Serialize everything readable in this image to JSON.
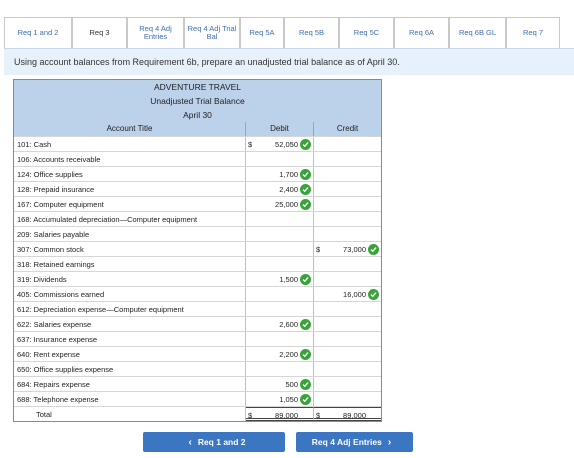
{
  "tabs": [
    {
      "label": "Req 1 and 2",
      "width": 68
    },
    {
      "label": "Req 3",
      "width": 55,
      "active": true
    },
    {
      "label": "Req 4 Adj Entries",
      "width": 57
    },
    {
      "label": "Req 4 Adj Trial Bal",
      "width": 56
    },
    {
      "label": "Req 5A",
      "width": 44
    },
    {
      "label": "Req 5B",
      "width": 55
    },
    {
      "label": "Req 5C",
      "width": 55
    },
    {
      "label": "Req 6A",
      "width": 55
    },
    {
      "label": "Req 6B GL",
      "width": 57
    },
    {
      "label": "Req 7",
      "width": 54
    }
  ],
  "instruction": "Using account balances from Requirement 6b, prepare an unadjusted trial balance as of April 30.",
  "trial_balance": {
    "company": "ADVENTURE TRAVEL",
    "report": "Unadjusted Trial Balance",
    "date": "April 30",
    "col_account": "Account Title",
    "col_debit": "Debit",
    "col_credit": "Credit",
    "rows": [
      {
        "account": "101: Cash",
        "debit_dollar": "$",
        "debit": "52,050",
        "debit_check": true,
        "credit_dollar": "",
        "credit": "",
        "credit_check": false
      },
      {
        "account": "106: Accounts receivable",
        "debit_dollar": "",
        "debit": "",
        "debit_check": false,
        "credit_dollar": "",
        "credit": "",
        "credit_check": false
      },
      {
        "account": "124: Office supplies",
        "debit_dollar": "",
        "debit": "1,700",
        "debit_check": true,
        "credit_dollar": "",
        "credit": "",
        "credit_check": false
      },
      {
        "account": "128: Prepaid insurance",
        "debit_dollar": "",
        "debit": "2,400",
        "debit_check": true,
        "credit_dollar": "",
        "credit": "",
        "credit_check": false
      },
      {
        "account": "167: Computer equipment",
        "debit_dollar": "",
        "debit": "25,000",
        "debit_check": true,
        "credit_dollar": "",
        "credit": "",
        "credit_check": false
      },
      {
        "account": "168: Accumulated depreciation—Computer equipment",
        "debit_dollar": "",
        "debit": "",
        "debit_check": false,
        "credit_dollar": "",
        "credit": "",
        "credit_check": false
      },
      {
        "account": "209: Salaries payable",
        "debit_dollar": "",
        "debit": "",
        "debit_check": false,
        "credit_dollar": "",
        "credit": "",
        "credit_check": false
      },
      {
        "account": "307: Common stock",
        "debit_dollar": "",
        "debit": "",
        "debit_check": false,
        "credit_dollar": "$",
        "credit": "73,000",
        "credit_check": true
      },
      {
        "account": "318: Retained earnings",
        "debit_dollar": "",
        "debit": "",
        "debit_check": false,
        "credit_dollar": "",
        "credit": "",
        "credit_check": false
      },
      {
        "account": "319: Dividends",
        "debit_dollar": "",
        "debit": "1,500",
        "debit_check": true,
        "credit_dollar": "",
        "credit": "",
        "credit_check": false
      },
      {
        "account": "405: Commissions earned",
        "debit_dollar": "",
        "debit": "",
        "debit_check": false,
        "credit_dollar": "",
        "credit": "16,000",
        "credit_check": true
      },
      {
        "account": "612: Depreciation expense—Computer equipment",
        "debit_dollar": "",
        "debit": "",
        "debit_check": false,
        "credit_dollar": "",
        "credit": "",
        "credit_check": false
      },
      {
        "account": "622: Salaries expense",
        "debit_dollar": "",
        "debit": "2,600",
        "debit_check": true,
        "credit_dollar": "",
        "credit": "",
        "credit_check": false
      },
      {
        "account": "637: Insurance expense",
        "debit_dollar": "",
        "debit": "",
        "debit_check": false,
        "credit_dollar": "",
        "credit": "",
        "credit_check": false
      },
      {
        "account": "640: Rent expense",
        "debit_dollar": "",
        "debit": "2,200",
        "debit_check": true,
        "credit_dollar": "",
        "credit": "",
        "credit_check": false
      },
      {
        "account": "650: Office supplies expense",
        "debit_dollar": "",
        "debit": "",
        "debit_check": false,
        "credit_dollar": "",
        "credit": "",
        "credit_check": false
      },
      {
        "account": "684: Repairs expense",
        "debit_dollar": "",
        "debit": "500",
        "debit_check": true,
        "credit_dollar": "",
        "credit": "",
        "credit_check": false
      },
      {
        "account": "688: Telephone expense",
        "debit_dollar": "",
        "debit": "1,050",
        "debit_check": true,
        "credit_dollar": "",
        "credit": "",
        "credit_check": false
      }
    ],
    "total": {
      "label": "Total",
      "debit_dollar": "$",
      "debit": "89,000",
      "credit_dollar": "$",
      "credit": "89,000"
    }
  },
  "nav": {
    "prev_label": "Req 1 and 2",
    "next_label": "Req 4 Adj Entries"
  },
  "colors": {
    "accent": "#3a76c2",
    "header_bg": "#bcd1ea",
    "banner_bg": "#e7f1fb",
    "check": "#3aa23a"
  }
}
